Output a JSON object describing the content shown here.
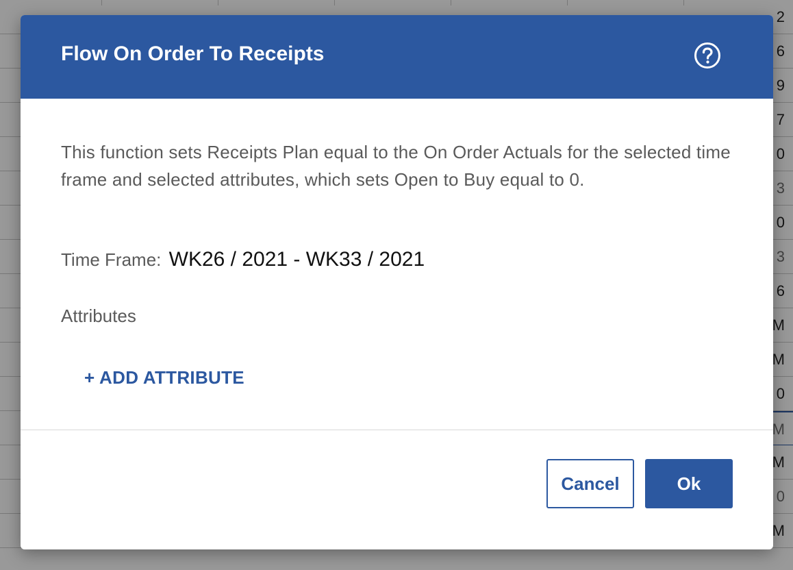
{
  "background": {
    "cells": [
      {
        "text": "2",
        "muted": false
      },
      {
        "text": "6",
        "muted": false
      },
      {
        "text": "9",
        "muted": false
      },
      {
        "text": "7",
        "muted": false
      },
      {
        "text": "0",
        "muted": false
      },
      {
        "text": "3",
        "muted": true
      },
      {
        "text": "0",
        "muted": false
      },
      {
        "text": "3",
        "muted": true
      },
      {
        "text": "6",
        "muted": false
      },
      {
        "text": "M",
        "muted": false
      },
      {
        "text": "M",
        "muted": false
      },
      {
        "text": "0",
        "muted": false
      },
      {
        "text": "M",
        "muted": true
      },
      {
        "text": "M",
        "muted": false
      },
      {
        "text": "0",
        "muted": true
      },
      {
        "text": "M",
        "muted": false
      }
    ]
  },
  "dialog": {
    "title": "Flow On Order To Receipts",
    "help_icon": "question-circle-icon",
    "description": "This function sets Receipts Plan equal to the On Order Actuals for the selected time frame and selected attributes, which sets Open to Buy equal to 0.",
    "time_frame_label": "Time Frame:",
    "time_frame_value": "WK26 / 2021 - WK33 / 2021",
    "attributes_label": "Attributes",
    "add_attribute_label": "+ ADD ATTRIBUTE",
    "cancel_label": "Cancel",
    "ok_label": "Ok"
  },
  "colors": {
    "primary": "#2c58a0",
    "text_muted": "#5a5a5a",
    "text_strong": "#111111"
  }
}
